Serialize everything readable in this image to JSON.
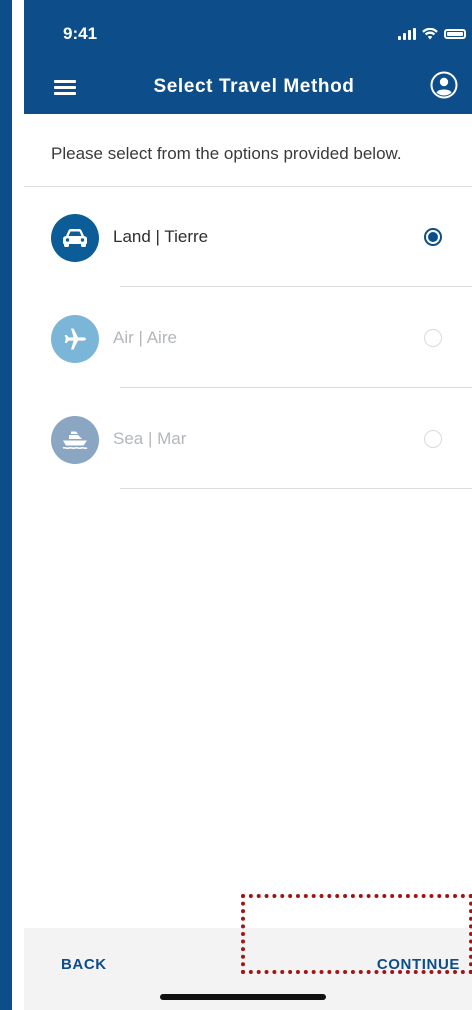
{
  "status_bar": {
    "time": "9:41"
  },
  "header": {
    "title": "Select Travel Method"
  },
  "subtitle": "Please select from the options provided below.",
  "options": [
    {
      "label": "Land | Tierre",
      "icon": "car-icon",
      "selected": true
    },
    {
      "label": "Air | Aire",
      "icon": "airplane-icon",
      "selected": false
    },
    {
      "label": "Sea | Mar",
      "icon": "boat-icon",
      "selected": false
    }
  ],
  "footer": {
    "back_label": "BACK",
    "continue_label": "CONTINUE"
  },
  "colors": {
    "primary": "#0c4d8a",
    "inactive_icon_air": "#7bb5d8",
    "inactive_icon_sea": "#8aa6c2",
    "selected_text": "#2e2e2e",
    "inactive_text": "#b3b7bb",
    "highlight": "#a31515"
  }
}
